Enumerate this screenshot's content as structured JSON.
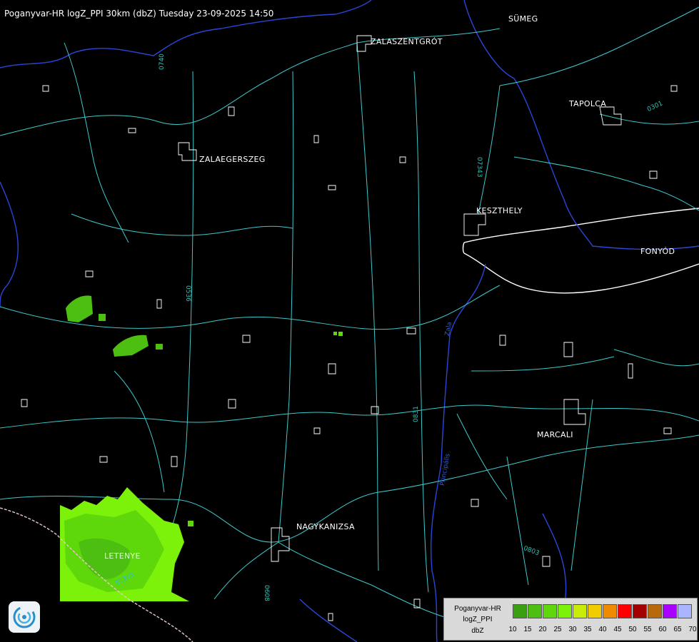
{
  "header": {
    "title": "Poganyvar-HR logZ_PPI 30km (dbZ) Tuesday 23-09-2025 14:50"
  },
  "cities": {
    "sumeg": "SÜMEG",
    "zalaszentgrot": "ZALASZENTGRÓT",
    "tapolca": "TAPOLCA",
    "zalaegerszeg": "ZALAEGERSZEG",
    "keszthely": "KESZTHELY",
    "fonyod": "FONYÓD",
    "marcali": "MARCALI",
    "nagykanizsa": "NAGYKANIZSA",
    "letenye": "LETENYE"
  },
  "roads": {
    "r0740": "0740",
    "r07343": "07343",
    "r0536": "0536",
    "r0831": "0831",
    "r0803": "0803",
    "r05395": "05395",
    "r0301": "0301",
    "r0608": "0608"
  },
  "rivers": {
    "zala": "Zala",
    "principalis": "Principális"
  },
  "legend": {
    "line1": "Poganyvar-HR",
    "line2": "logZ_PPI",
    "line3": "dbZ",
    "colors": [
      "#3aa012",
      "#4cbf10",
      "#5ed80a",
      "#7cf20a",
      "#c9ec08",
      "#f0cc00",
      "#f08a00",
      "#ff0000",
      "#a40000",
      "#b86a0a",
      "#aa00ff",
      "#aab4ff"
    ],
    "ticks": [
      "10",
      "15",
      "20",
      "25",
      "30",
      "35",
      "40",
      "45",
      "50",
      "55",
      "60",
      "65",
      "70"
    ]
  }
}
